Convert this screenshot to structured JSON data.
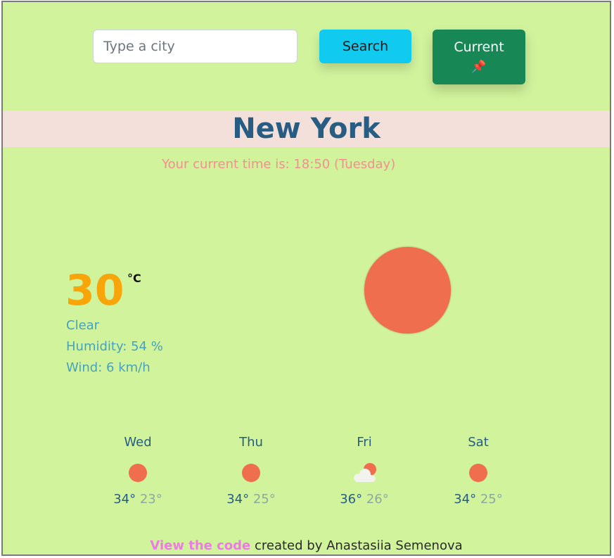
{
  "search": {
    "placeholder": "Type a city",
    "value": "",
    "button_label": "Search",
    "current_button_label": "Current",
    "current_icon": "📌"
  },
  "city": {
    "name": "New York"
  },
  "time": {
    "text": "Your current time is: 18:50 (Tuesday)"
  },
  "weather": {
    "temperature": "30",
    "unit": "°C",
    "description": "Clear",
    "humidity": "Humidity: 54 %",
    "wind": "Wind: 6 km/h",
    "icon": "sun-icon"
  },
  "forecast": [
    {
      "day": "Wed",
      "icon": "sun-icon",
      "max": "34°",
      "min": "23°"
    },
    {
      "day": "Thu",
      "icon": "sun-icon",
      "max": "34°",
      "min": "25°"
    },
    {
      "day": "Fri",
      "icon": "cloud-sun-icon",
      "max": "36°",
      "min": "26°"
    },
    {
      "day": "Sat",
      "icon": "sun-icon",
      "max": "34°",
      "min": "25°"
    }
  ],
  "footer": {
    "link_text": "View the code",
    "text": " created by Anastasiia Semenova"
  },
  "colors": {
    "background": "#d1f39c",
    "accent_search": "#11caf0",
    "accent_current": "#178755",
    "sun": "#ee6e4e",
    "temperature": "#f8a50a"
  }
}
